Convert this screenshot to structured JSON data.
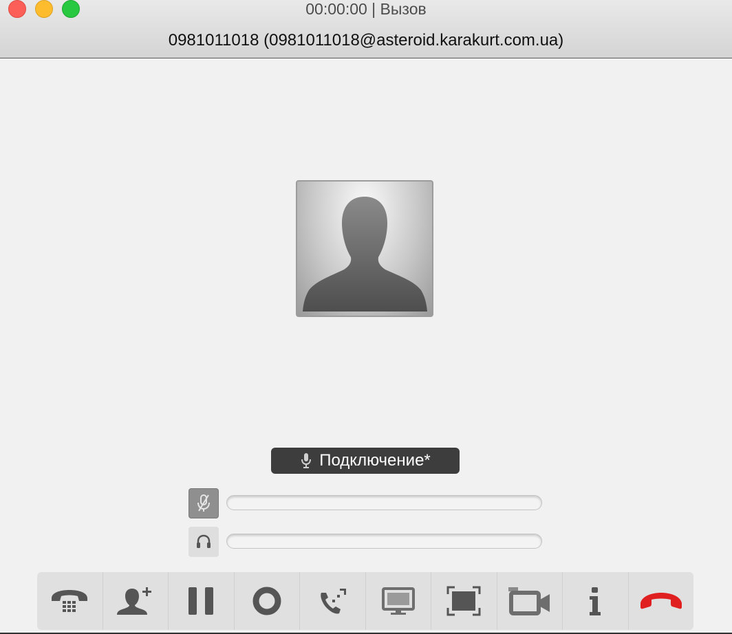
{
  "window": {
    "title": "00:00:00 | Вызов",
    "remote_party": "0981011018 (0981011018@asteroid.karakurt.com.ua)"
  },
  "contact": {
    "avatar_icon": "person-silhouette-icon"
  },
  "status": {
    "text": "Подключение*",
    "icon": "microphone-icon"
  },
  "levels": {
    "microphone": {
      "icon": "microphone-muted-icon",
      "level": 0
    },
    "speaker": {
      "icon": "headphones-icon",
      "level": 0
    }
  },
  "toolbar": {
    "buttons": [
      {
        "name": "dialpad",
        "icon": "dialpad-phone-icon"
      },
      {
        "name": "add-participant",
        "icon": "add-user-icon"
      },
      {
        "name": "hold",
        "icon": "pause-icon"
      },
      {
        "name": "record",
        "icon": "record-icon"
      },
      {
        "name": "transfer",
        "icon": "call-transfer-icon"
      },
      {
        "name": "screen-share",
        "icon": "screen-share-icon"
      },
      {
        "name": "fullscreen",
        "icon": "fullscreen-icon"
      },
      {
        "name": "video",
        "icon": "video-camera-icon"
      },
      {
        "name": "info",
        "icon": "info-icon"
      },
      {
        "name": "hangup",
        "icon": "hang-up-icon"
      }
    ],
    "hangup_color": "#e02020",
    "icon_color": "#555555"
  }
}
